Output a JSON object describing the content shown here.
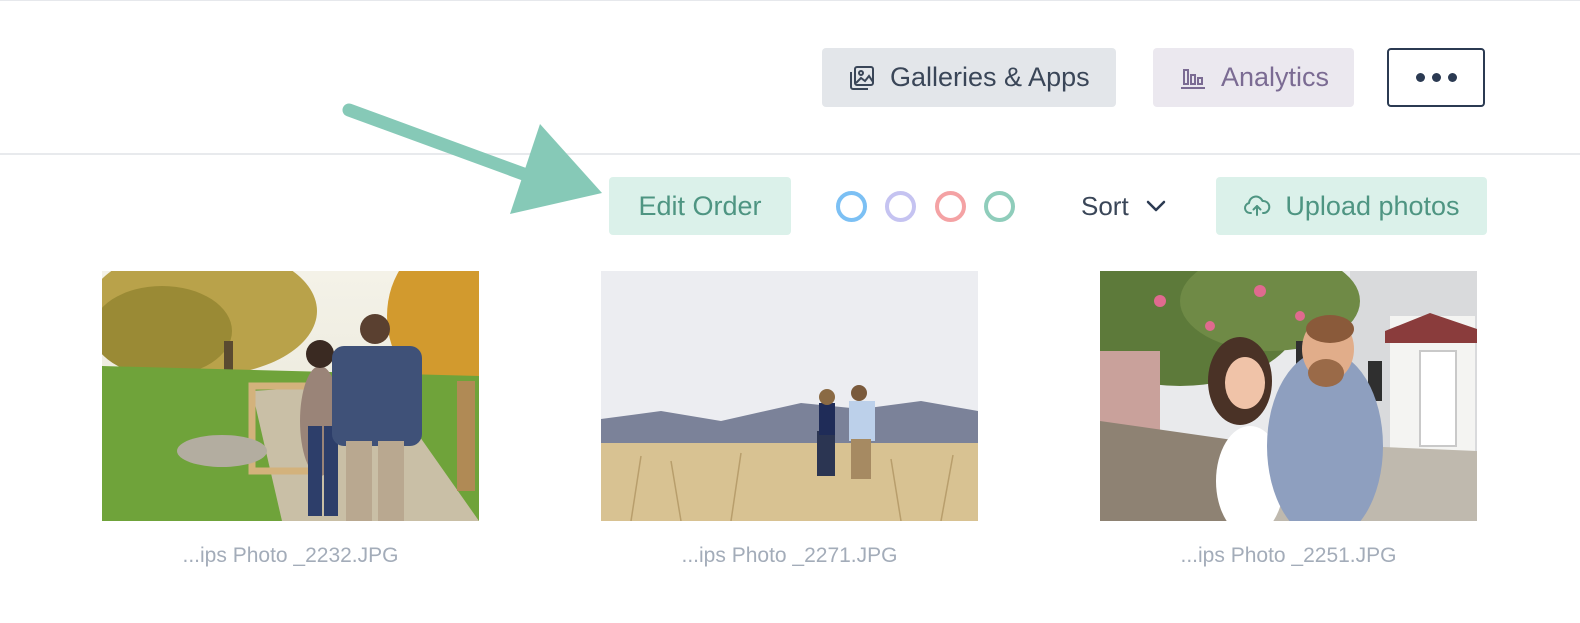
{
  "header": {
    "galleries_label": "Galleries & Apps",
    "analytics_label": "Analytics",
    "galleries_icon": "image-gallery-icon",
    "analytics_icon": "bar-chart-icon",
    "more_icon": "more-dots-icon"
  },
  "toolbar": {
    "edit_order_label": "Edit Order",
    "sort_label": "Sort",
    "upload_label": "Upload photos",
    "upload_icon": "cloud-upload-icon",
    "color_filters": [
      {
        "name": "blue",
        "color": "#7cc0f4"
      },
      {
        "name": "lavender",
        "color": "#c5c3f1"
      },
      {
        "name": "red",
        "color": "#f4a2a4"
      },
      {
        "name": "green",
        "color": "#8fcdbb"
      }
    ]
  },
  "annotation": {
    "arrow_color": "#86c9b7"
  },
  "photos": [
    {
      "caption": "...ips Photo _2232.JPG"
    },
    {
      "caption": "...ips Photo _2271.JPG"
    },
    {
      "caption": "...ips Photo _2251.JPG"
    }
  ]
}
